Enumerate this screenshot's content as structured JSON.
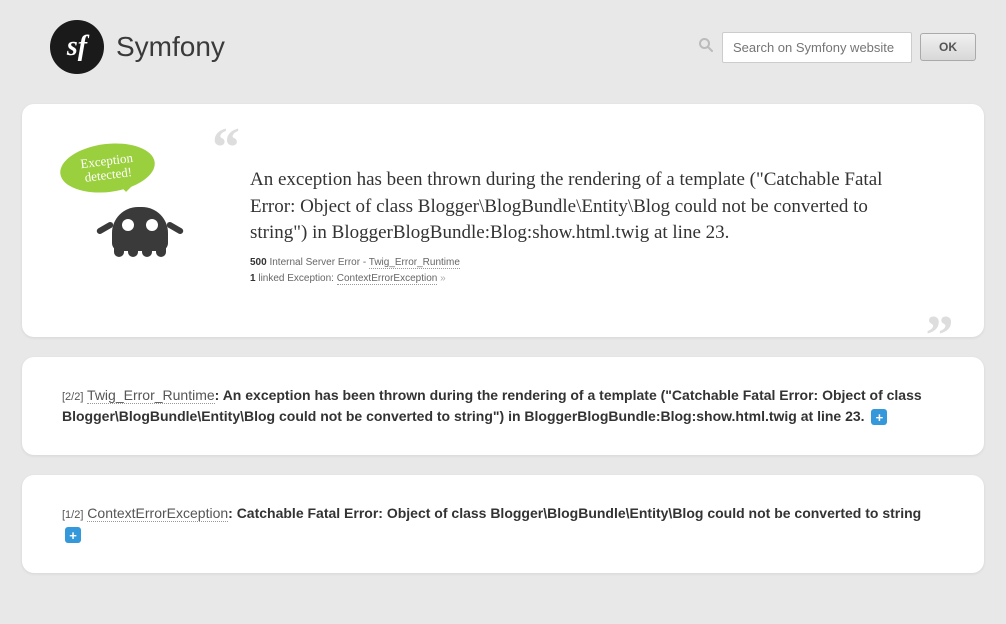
{
  "header": {
    "brand": "Symfony",
    "logo_text": "sf",
    "search_placeholder": "Search on Symfony website",
    "ok_label": "OK"
  },
  "main_error": {
    "bubble_text": "Exception detected!",
    "message": "An exception has been thrown during the rendering of a template (\"Catchable Fatal Error: Object of class Blogger\\BlogBundle\\Entity\\Blog could not be converted to string\") in BloggerBlogBundle:Blog:show.html.twig at line 23.",
    "status_code": "500",
    "status_text": "Internal Server Error - ",
    "error_class": "Twig_Error_Runtime",
    "linked_count": "1",
    "linked_text": " linked Exception: ",
    "linked_class": "ContextErrorException"
  },
  "traces": [
    {
      "index": "[2/2]",
      "class": "Twig_Error_Runtime",
      "message": ": An exception has been thrown during the rendering of a template (\"Catchable Fatal Error: Object of class Blogger\\BlogBundle\\Entity\\Blog could not be converted to string\") in BloggerBlogBundle:Blog:show.html.twig at line 23."
    },
    {
      "index": "[1/2]",
      "class": "ContextErrorException",
      "message": ": Catchable Fatal Error: Object of class Blogger\\BlogBundle\\Entity\\Blog could not be converted to string"
    }
  ]
}
